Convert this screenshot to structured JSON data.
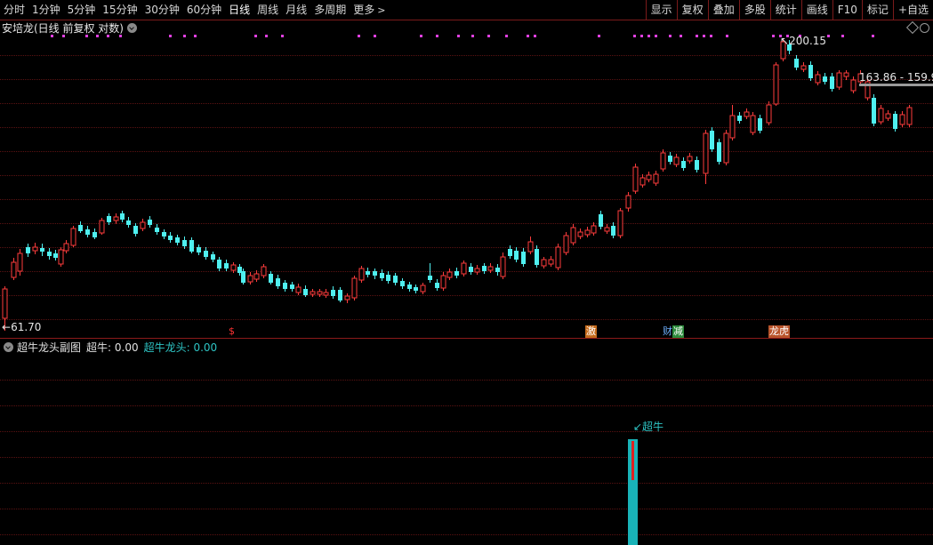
{
  "toolbar": {
    "periods": [
      "分时",
      "1分钟",
      "5分钟",
      "15分钟",
      "30分钟",
      "60分钟",
      "日线",
      "周线",
      "月线",
      "多周期",
      "更多"
    ],
    "active_period": "日线",
    "tools": [
      "显示",
      "复权",
      "叠加",
      "多股",
      "统计",
      "画线",
      "F10",
      "标记",
      "+自选"
    ]
  },
  "main_chart": {
    "title": "安培龙(日线 前复权 对数)",
    "high_label": "200.15",
    "low_label": "61.70",
    "price_box": "163.86 - 159.9",
    "markers": {
      "s": "$",
      "ji": "激",
      "cai": "财",
      "jian": "减",
      "long": "龙虎"
    },
    "colors": {
      "up": "#ff3c3c",
      "down": "#4ff0f0",
      "signal_dots": "#e040e0"
    }
  },
  "sub_chart": {
    "title": "超牛龙头副图",
    "label1": "超牛: 0.00",
    "label2": "超牛龙头: 0.00",
    "annotation": "↙超牛",
    "colors": {
      "bar": "#19b3b8",
      "core": "#e02020"
    }
  }
}
